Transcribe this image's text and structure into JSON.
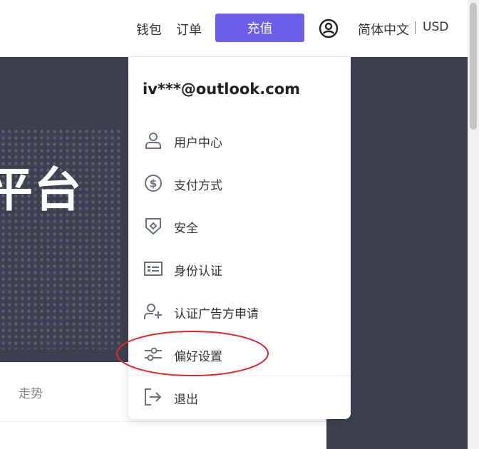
{
  "nav": {
    "wallet": "钱包",
    "orders": "订单",
    "recharge": "充值",
    "language": "简体中文",
    "currency": "USD"
  },
  "hero": {
    "title": "平台"
  },
  "tabs": {
    "trend": "走势"
  },
  "account_menu": {
    "email": "iv***@outlook.com",
    "items": [
      {
        "label": "用户中心",
        "icon": "user-icon"
      },
      {
        "label": "支付方式",
        "icon": "dollar-icon"
      },
      {
        "label": "安全",
        "icon": "shield-icon"
      },
      {
        "label": "身份认证",
        "icon": "id-card-icon"
      },
      {
        "label": "认证广告方申请",
        "icon": "user-plus-icon"
      },
      {
        "label": "偏好设置",
        "icon": "sliders-icon"
      }
    ],
    "logout": {
      "label": "退出",
      "icon": "logout-icon"
    }
  },
  "colors": {
    "accent": "#6c5dea",
    "hero_bg": "#3c4050",
    "annotation": "#e0282e"
  }
}
